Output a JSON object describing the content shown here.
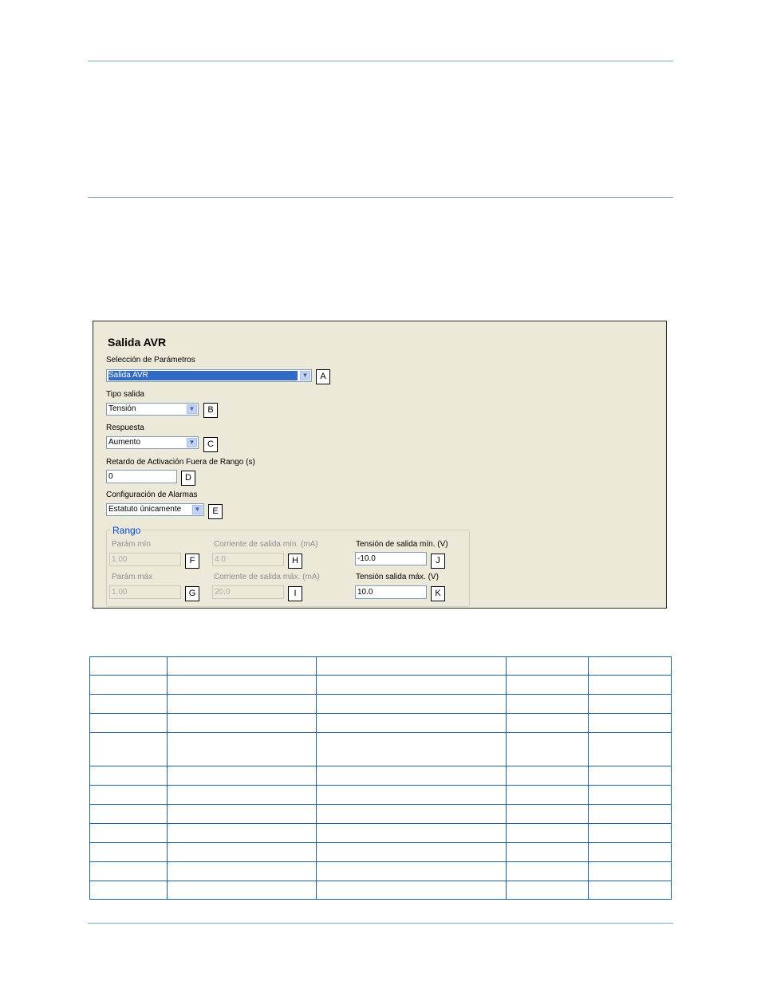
{
  "panel": {
    "title": "Salida AVR",
    "param_selection": {
      "label": "Selección de Parámetros",
      "value": "Salida AVR",
      "tag": "A"
    },
    "output_type": {
      "label": "Tipo salida",
      "value": "Tensión",
      "tag": "B"
    },
    "response": {
      "label": "Respuesta",
      "value": "Aumento",
      "tag": "C"
    },
    "out_of_range_delay": {
      "label": "Retardo de Activación Fuera de Rango (s)",
      "value": "0",
      "tag": "D"
    },
    "alarm_config": {
      "label": "Configuración de Alarmas",
      "value": "Estatuto únicamente",
      "tag": "E"
    },
    "range": {
      "legend": "Rango",
      "param_min": {
        "label": "Parám mín",
        "value": "1.00",
        "tag": "F"
      },
      "param_max": {
        "label": "Parám máx",
        "value": "1.00",
        "tag": "G"
      },
      "current_min": {
        "label": "Corriente de salida mín. (mA)",
        "value": "4.0",
        "tag": "H"
      },
      "current_max": {
        "label": "Corriente de salida máx. (mA)",
        "value": "20.0",
        "tag": "I"
      },
      "voltage_min": {
        "label": "Tensión de salida mín. (V)",
        "value": "-10.0",
        "tag": "J"
      },
      "voltage_max": {
        "label": "Tensión salida máx. (V)",
        "value": "10.0",
        "tag": "K"
      }
    }
  }
}
